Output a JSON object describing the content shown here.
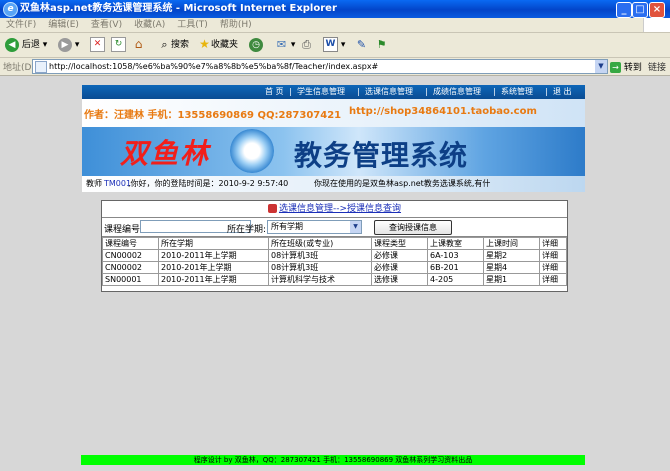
{
  "window": {
    "title": "双鱼林asp.net教务选课管理系统 - Microsoft Internet Explorer"
  },
  "menu": [
    "文件(F)",
    "编辑(E)",
    "查看(V)",
    "收藏(A)",
    "工具(T)",
    "帮助(H)"
  ],
  "toolbar": {
    "back": "后退",
    "search": "搜索",
    "favorites": "收藏夹"
  },
  "address": {
    "label": "地址(D)",
    "url": "http://localhost:1058/%e6%ba%90%e7%a8%8b%e5%ba%8f/Teacher/index.aspx#",
    "go": "转到",
    "links": "链接"
  },
  "banner": {
    "nav": [
      "首 页",
      "学生信息管理",
      "选课信息管理",
      "成绩信息管理",
      "系统管理",
      "退 出"
    ],
    "author": "作者：汪建林  手机：13558690869 QQ:287307421",
    "shop": "http://shop34864101.taobao.com",
    "logo_left": "双鱼林",
    "logo_right": "教务管理系统",
    "welcome_prefix": "教师",
    "user_id": "TM001",
    "welcome_suffix": ",你好，你的登陆时间是：2010-9-2 9:57:40",
    "using": "你现在使用的是双鱼林asp.net教务选课系统,有什"
  },
  "panel": {
    "title": "选课信息管理-->授课信息查询",
    "course_no_label": "课程编号",
    "course_no_value": "",
    "term_label": "所在学期:",
    "term_value": "所有学期",
    "query_button": "查询授课信息",
    "columns": [
      "课程编号",
      "所在学期",
      "所在班级(或专业)",
      "课程类型",
      "上课教室",
      "上课时间",
      "详细"
    ],
    "rows": [
      [
        "CN00002",
        "2010-2011年上学期",
        "08计算机3班",
        "必修课",
        "6A-103",
        "星期2",
        "详细"
      ],
      [
        "CN00002",
        "2010-201年上学期",
        "08计算机3班",
        "必修课",
        "6B-201",
        "星期4",
        "详细"
      ],
      [
        "SN00001",
        "2010-2011年上学期",
        "计算机科学与技术",
        "选修课",
        "4-205",
        "星期1",
        "详细"
      ]
    ]
  },
  "footer": "程序设计 by 双鱼林，QQ：287307421 手机：13558690869 双鱼林系列学习资料出品",
  "colors": {
    "titlebar": "#0345c9",
    "banner": "#0d5aa8",
    "author_text": "#e87a12",
    "logo_left": "#f11f1b",
    "logo_right": "#0d3f86",
    "footer_bg": "#00ff00",
    "link": "#1b2fb8"
  }
}
